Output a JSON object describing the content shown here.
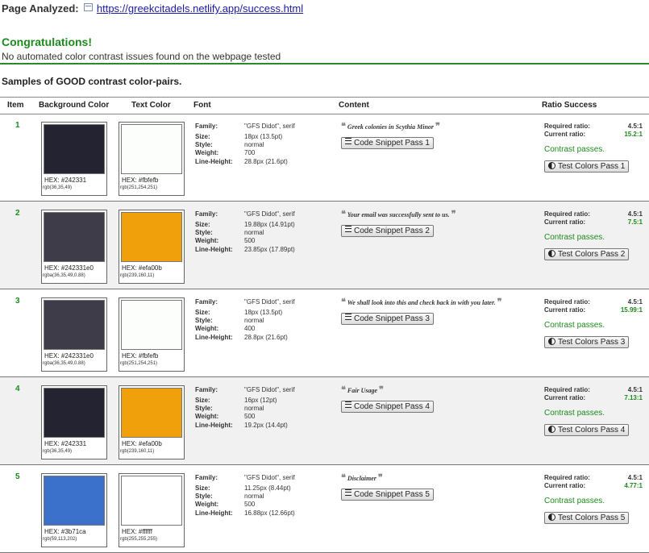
{
  "header": {
    "page_analyzed_label": "Page Analyzed:",
    "url": "https://greekcitadels.netlify.app/success.html",
    "congrats": "Congratulations!",
    "no_issues": "No automated color contrast issues found on the webpage tested",
    "samples_title": "Samples of GOOD contrast color-pairs."
  },
  "table": {
    "headers": {
      "item": "Item",
      "bg": "Background Color",
      "text": "Text Color",
      "font": "Font",
      "content": "Content",
      "ratio": "Ratio Success"
    },
    "font_labels": {
      "family": "Family:",
      "size": "Size:",
      "style": "Style:",
      "weight": "Weight:",
      "line_height": "Line-Height:"
    },
    "ratio_labels": {
      "required": "Required ratio:",
      "current": "Current ratio:",
      "passes": "Contrast passes."
    },
    "rows": [
      {
        "item": "1",
        "bg": {
          "color": "#242331",
          "hex": "HEX: #242331",
          "rgb": "rgb(36,35,49)"
        },
        "fg": {
          "color": "#fbfefb",
          "hex": "HEX: #fbfefb",
          "rgb": "rgb(251,254,251)"
        },
        "font": {
          "family": "\"GFS Didot\", serif",
          "size": "18px (13.5pt)",
          "style": "normal",
          "weight": "700",
          "line_height": "28.8px (21.6pt)"
        },
        "content": "Greek colonies in Scythia Minor",
        "snippet": "Code Snippet Pass 1",
        "required": "4.5:1",
        "current": "15.2:1",
        "test": "Test Colors Pass 1"
      },
      {
        "item": "2",
        "bg": {
          "color": "#3d3c48",
          "hex": "HEX: #242331e0",
          "rgb": "rgba(36,35,49,0.88)"
        },
        "fg": {
          "color": "#efa00b",
          "hex": "HEX: #efa00b",
          "rgb": "rgb(239,160,11)"
        },
        "font": {
          "family": "\"GFS Didot\", serif",
          "size": "19.88px (14.91pt)",
          "style": "normal",
          "weight": "500",
          "line_height": "23.85px (17.89pt)"
        },
        "content": "Your email was successfully sent to us.",
        "snippet": "Code Snippet Pass 2",
        "required": "4.5:1",
        "current": "7.5:1",
        "test": "Test Colors Pass 2"
      },
      {
        "item": "3",
        "bg": {
          "color": "#3d3c48",
          "hex": "HEX: #242331e0",
          "rgb": "rgba(36,35,49,0.88)"
        },
        "fg": {
          "color": "#fbfefb",
          "hex": "HEX: #fbfefb",
          "rgb": "rgb(251,254,251)"
        },
        "font": {
          "family": "\"GFS Didot\", serif",
          "size": "18px (13.5pt)",
          "style": "normal",
          "weight": "400",
          "line_height": "28.8px (21.6pt)"
        },
        "content": "We shall look into this and check back in with you later.",
        "snippet": "Code Snippet Pass 3",
        "required": "4.5:1",
        "current": "15.99:1",
        "test": "Test Colors Pass 3"
      },
      {
        "item": "4",
        "bg": {
          "color": "#242331",
          "hex": "HEX: #242331",
          "rgb": "rgb(36,35,49)"
        },
        "fg": {
          "color": "#efa00b",
          "hex": "HEX: #efa00b",
          "rgb": "rgb(239,160,11)"
        },
        "font": {
          "family": "\"GFS Didot\", serif",
          "size": "16px (12pt)",
          "style": "normal",
          "weight": "500",
          "line_height": "19.2px (14.4pt)"
        },
        "content": "Fair Usage",
        "snippet": "Code Snippet Pass 4",
        "required": "4.5:1",
        "current": "7.13:1",
        "test": "Test Colors Pass 4"
      },
      {
        "item": "5",
        "bg": {
          "color": "#3b71ca",
          "hex": "HEX: #3b71ca",
          "rgb": "rgb(59,113,202)"
        },
        "fg": {
          "color": "#ffffff",
          "hex": "HEX: #ffffff",
          "rgb": "rgb(255,255,255)"
        },
        "font": {
          "family": "\"GFS Didot\", serif",
          "size": "11.25px (8.44pt)",
          "style": "normal",
          "weight": "500",
          "line_height": "16.88px (12.66pt)"
        },
        "content": "Disclaimer",
        "snippet": "Code Snippet Pass 5",
        "required": "4.5:1",
        "current": "4.77:1",
        "test": "Test Colors Pass 5"
      }
    ]
  },
  "colors": {
    "accent_green": "#1d8a1d",
    "link": "#1a1aa6"
  }
}
